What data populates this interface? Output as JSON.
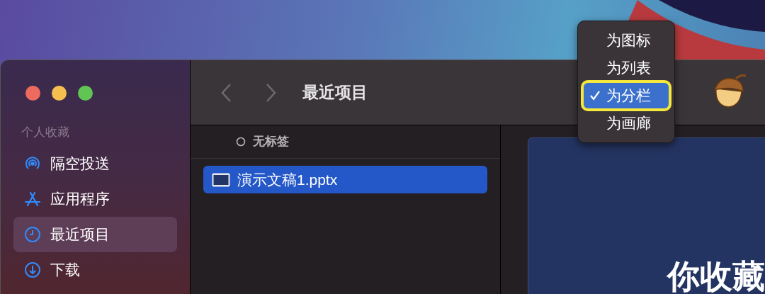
{
  "window": {
    "title": "最近项目"
  },
  "sidebar": {
    "section": "个人收藏",
    "items": [
      {
        "label": "隔空投送",
        "kind": "airdrop",
        "selected": false
      },
      {
        "label": "应用程序",
        "kind": "apps",
        "selected": false
      },
      {
        "label": "最近项目",
        "kind": "clock",
        "selected": true
      },
      {
        "label": "下载",
        "kind": "download",
        "selected": false
      }
    ]
  },
  "column": {
    "tag_header": "无标签",
    "files": [
      {
        "name": "演示文稿1.pptx",
        "selected": true
      }
    ]
  },
  "preview": {
    "slide_text": "你收藏"
  },
  "view_menu": {
    "items": [
      {
        "label": "为图标",
        "selected": false
      },
      {
        "label": "为列表",
        "selected": false
      },
      {
        "label": "为分栏",
        "selected": true
      },
      {
        "label": "为画廊",
        "selected": false
      }
    ]
  }
}
